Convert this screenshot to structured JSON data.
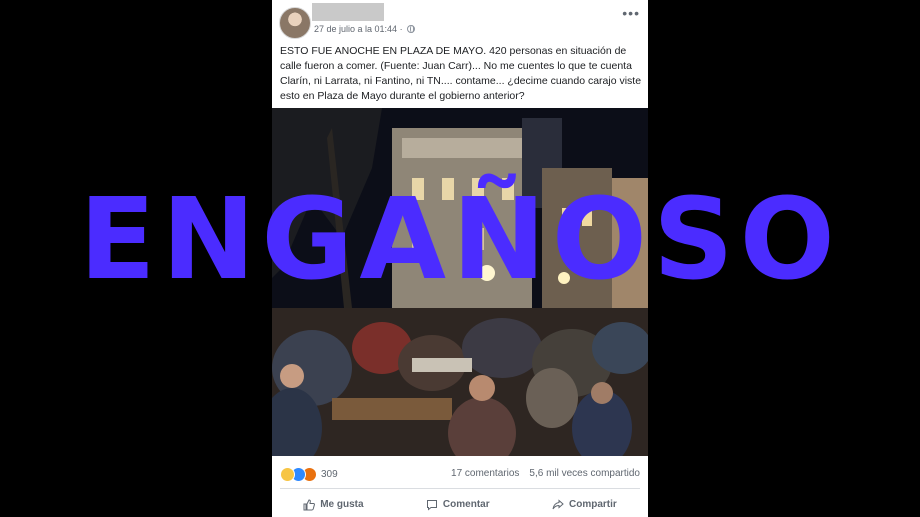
{
  "post": {
    "timestamp": "27 de julio a la 01:44 ·",
    "text": "ESTO FUE ANOCHE EN PLAZA DE MAYO. 420 personas en situación de calle fueron a comer. (Fuente: Juan Carr)... No me cuentes lo que te cuenta Clarín, ni Larrata, ni Fantino, ni TN.... contame... ¿decime cuando carajo viste esto en Plaza de Mayo durante el gobierno anterior?",
    "icons": {
      "more": "more-options-icon",
      "globe": "globe-icon",
      "reactions": [
        "sad-reaction-icon",
        "like-reaction-icon",
        "angry-reaction-icon"
      ]
    },
    "stats": {
      "reaction_count": "309",
      "comments": "17 comentarios",
      "shares": "5,6 mil veces compartido"
    },
    "actions": {
      "like": "Me gusta",
      "comment": "Comentar",
      "share": "Compartir"
    }
  },
  "overlay": {
    "stamp": "ENGAÑOSO",
    "color": "#4b2cff"
  },
  "colors": {
    "background": "#000000",
    "card": "#ffffff",
    "muted_text": "#606770",
    "like_blue": "#2e89ff"
  }
}
